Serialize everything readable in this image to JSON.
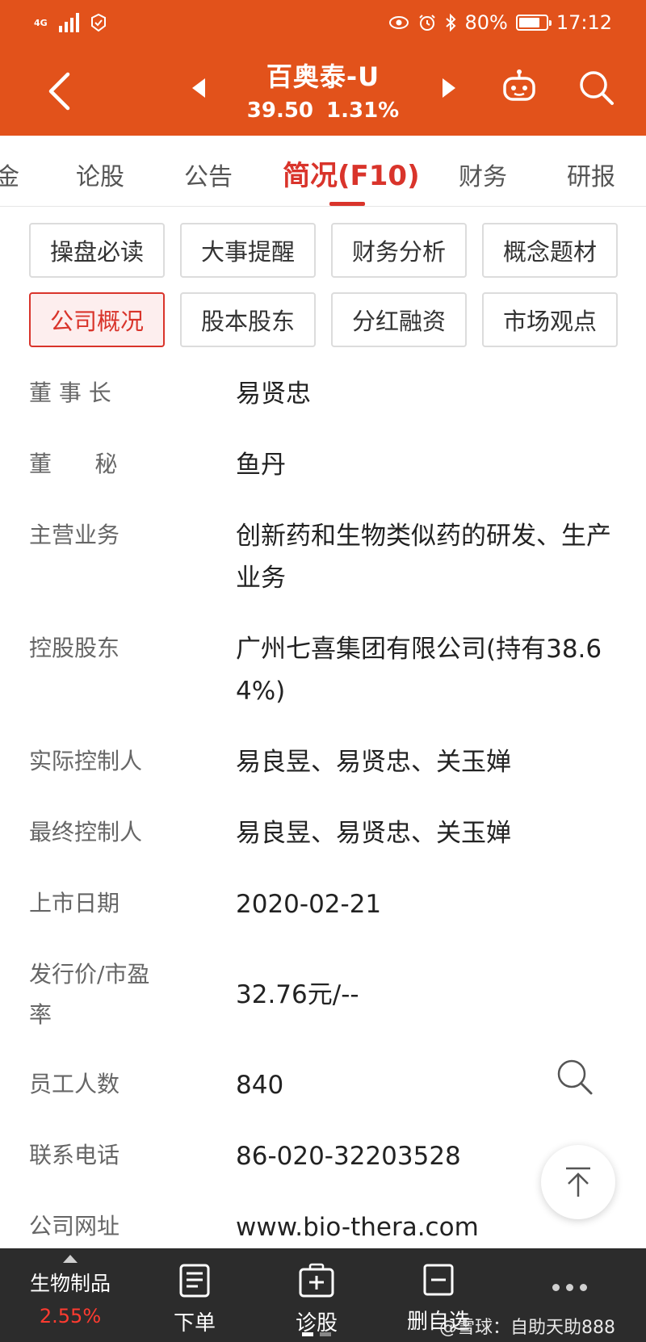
{
  "status_bar": {
    "network": "4G",
    "battery": "80%",
    "battery_level": 0.8,
    "time": "17:12"
  },
  "header": {
    "stock_name": "百奥泰-U",
    "price": "39.50",
    "change_pct": "1.31%",
    "bg_color": "#e2521b"
  },
  "tabs": [
    {
      "label": "金"
    },
    {
      "label": "论股"
    },
    {
      "label": "公告"
    },
    {
      "label": "简况(F10)",
      "active": true
    },
    {
      "label": "财务"
    },
    {
      "label": "研报"
    }
  ],
  "chips": [
    {
      "label": "操盘必读"
    },
    {
      "label": "大事提醒"
    },
    {
      "label": "财务分析"
    },
    {
      "label": "概念题材"
    },
    {
      "label": "公司概况",
      "active": true
    },
    {
      "label": "股本股东"
    },
    {
      "label": "分红融资"
    },
    {
      "label": "市场观点"
    }
  ],
  "info_rows": [
    {
      "label": "董 事 长",
      "value": "易贤忠"
    },
    {
      "label": "董      秘",
      "value": "鱼丹"
    },
    {
      "label": "主营业务",
      "value": "创新药和生物类似药的研发、生产业务"
    },
    {
      "label": "控股股东",
      "value": "广州七喜集团有限公司(持有38.64%)"
    },
    {
      "label": "实际控制人",
      "value": "易良昱、易贤忠、关玉婵"
    },
    {
      "label": "最终控制人",
      "value": "易良昱、易贤忠、关玉婵"
    },
    {
      "label": "上市日期",
      "value": "2020-02-21"
    },
    {
      "label": "发行价/市盈率",
      "value": "32.76元/--"
    },
    {
      "label": "员工人数",
      "value": "840"
    },
    {
      "label": "联系电话",
      "value": "86-020-32203528"
    },
    {
      "label": "公司网址",
      "value": "www.bio-thera.com"
    }
  ],
  "bottom_bar": {
    "sector_name": "生物制品",
    "sector_change": "2.55%",
    "items": [
      {
        "label": "下单",
        "icon": "order-document-icon"
      },
      {
        "label": "诊股",
        "icon": "diagnose-plus-icon"
      },
      {
        "label": "删自选",
        "icon": "remove-watchlist-icon"
      }
    ],
    "watermark": "@雪球：自助天助888"
  },
  "colors": {
    "accent_red": "#d9342b",
    "header_orange": "#e2521b",
    "bottom_dark": "#2c2c2c"
  }
}
